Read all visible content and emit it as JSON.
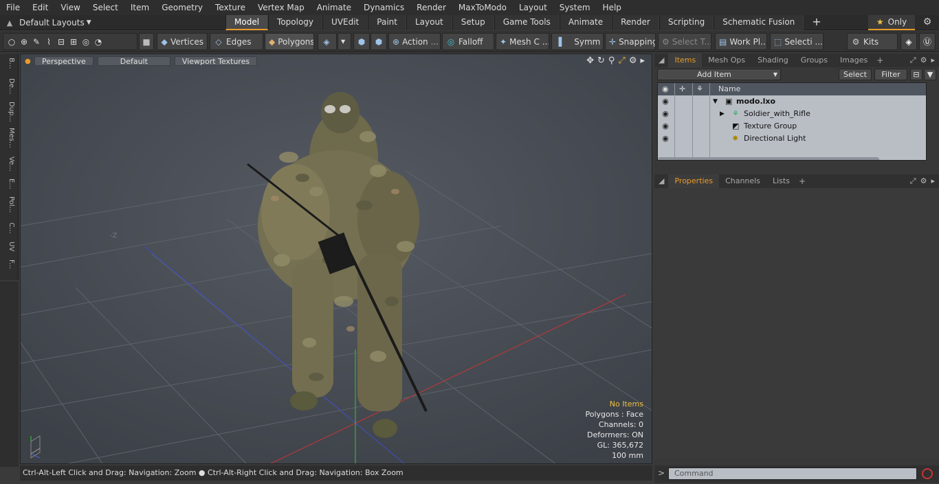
{
  "menu": [
    "File",
    "Edit",
    "View",
    "Select",
    "Item",
    "Geometry",
    "Texture",
    "Vertex Map",
    "Animate",
    "Dynamics",
    "Render",
    "MaxToModo",
    "Layout",
    "System",
    "Help"
  ],
  "layout_selector": "Default Layouts",
  "tabs": [
    "Model",
    "Topology",
    "UVEdit",
    "Paint",
    "Layout",
    "Setup",
    "Game Tools",
    "Animate",
    "Render",
    "Scripting",
    "Schematic Fusion"
  ],
  "active_tab": "Model",
  "only_label": "Only",
  "toolbar": {
    "vertices": "Vertices",
    "edges": "Edges",
    "polygons": "Polygons",
    "action": "Action",
    "falloff": "Falloff",
    "mesh": "Mesh C ...",
    "symmetry": "Symm ...",
    "snapping": "Snapping",
    "select_t": "Select T...",
    "workplane": "Work Pl...",
    "selection": "Selecti ...",
    "kits": "Kits"
  },
  "left_strip": [
    "B...",
    "De...",
    "Dup...",
    "Mes...",
    "Ve...",
    "E...",
    "Pol...",
    "C...",
    "UV",
    "F..."
  ],
  "viewport": {
    "projection": "Perspective",
    "shading": "Default",
    "textures": "Viewport Textures",
    "axis_label": "-Z",
    "info": {
      "items": "No Items",
      "polygons": "Polygons : Face",
      "channels": "Channels: 0",
      "deformers": "Deformers: ON",
      "gl": "GL: 365,672",
      "scale": "100 mm"
    }
  },
  "status_hint": "Ctrl-Alt-Left Click and Drag: Navigation: Zoom ● Ctrl-Alt-Right Click and Drag: Navigation: Box Zoom",
  "items_panel": {
    "tabs": [
      "Items",
      "Mesh Ops",
      "Shading",
      "Groups",
      "Images"
    ],
    "active": "Items",
    "add_item": "Add Item",
    "select": "Select",
    "filter": "Filter",
    "name_header": "Name",
    "rows": [
      {
        "label": "modo.lxo"
      },
      {
        "label": "Soldier_with_Rifle"
      },
      {
        "label": "Texture Group"
      },
      {
        "label": "Directional Light"
      }
    ]
  },
  "props_panel": {
    "tabs": [
      "Properties",
      "Channels",
      "Lists"
    ],
    "active": "Properties"
  },
  "command_placeholder": "Command",
  "colors": {
    "accent": "#e89c2a",
    "viewport_bg": "#4b5058",
    "panel_bg": "#383838"
  }
}
